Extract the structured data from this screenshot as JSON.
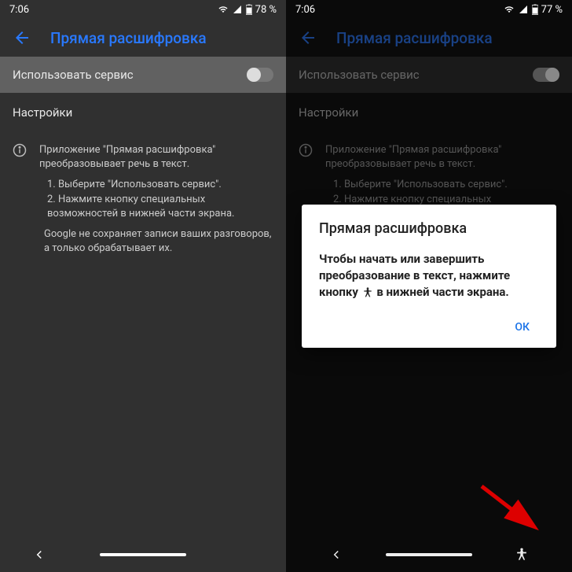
{
  "left": {
    "status": {
      "time": "7:06",
      "battery": "78 %"
    },
    "title": "Прямая расшифровка",
    "service_label": "Использовать сервис",
    "settings_label": "Настройки",
    "info": {
      "line1": "Приложение \"Прямая расшифровка\" преобразовывает речь в текст.",
      "step1": "1. Выберите \"Использовать сервис\".",
      "step2": "2. Нажмите кнопку специальных возможностей в нижней части экрана.",
      "line3": "Google не сохраняет записи ваших разговоров, а только обрабатывает их."
    }
  },
  "right": {
    "status": {
      "time": "7:06",
      "battery": "77 %"
    },
    "title": "Прямая расшифровка",
    "service_label": "Использовать сервис",
    "settings_label": "Настройки",
    "info": {
      "line1": "Приложение \"Прямая расшифровка\" преобразовывает речь в текст.",
      "step1": "1. Выберите \"Использовать сервис\".",
      "step2": "2. Нажмите кнопку специальных возможностей"
    },
    "dialog": {
      "title": "Прямая расшифровка",
      "body_before": "Чтобы начать или завершить преобразование в текст, нажмите кнопку ",
      "body_after": " в нижней части экрана.",
      "ok": "ОК"
    }
  }
}
